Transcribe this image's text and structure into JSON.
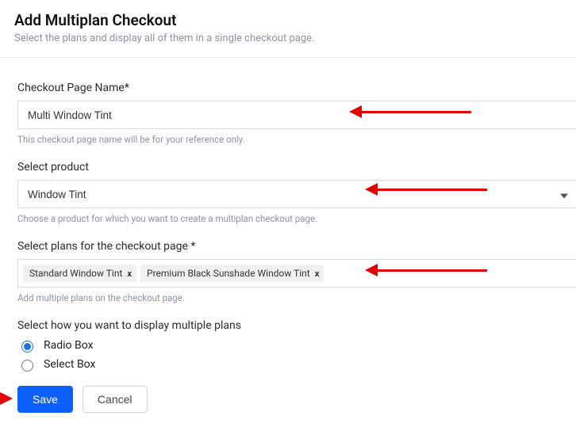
{
  "header": {
    "title": "Add Multiplan Checkout",
    "subtitle": "Select the plans and display all of them in a single checkout page."
  },
  "fields": {
    "checkout_name": {
      "label": "Checkout Page Name*",
      "value": "Multi Window Tint",
      "helper": "This checkout page name will be for your reference only."
    },
    "product": {
      "label": "Select product",
      "value": "Window Tint",
      "helper": "Choose a product for which you want to create a multiplan checkout page."
    },
    "plans": {
      "label": "Select plans for the checkout page *",
      "chips": [
        "Standard Window Tint",
        "Premium Black Sunshade Window Tint"
      ],
      "helper": "Add multiple plans on the checkout page."
    },
    "display_mode": {
      "label": "Select how you want to display multiple plans",
      "options": [
        "Radio Box",
        "Select Box"
      ],
      "selected": "Radio Box"
    }
  },
  "buttons": {
    "save": "Save",
    "cancel": "Cancel"
  }
}
